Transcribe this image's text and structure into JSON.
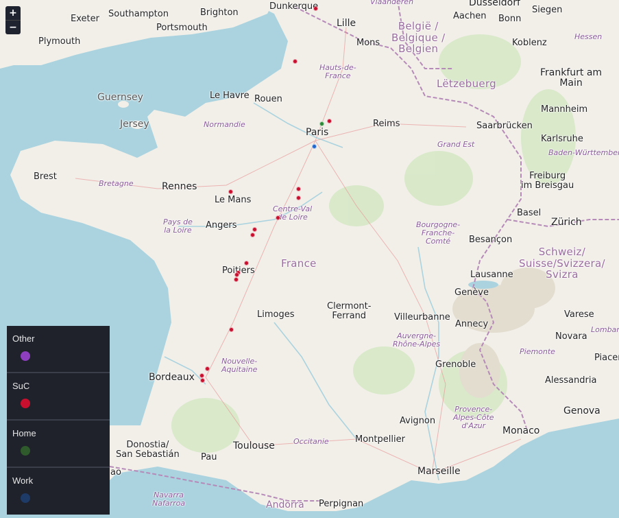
{
  "zoom": {
    "in_label": "+",
    "out_label": "−"
  },
  "places": {
    "dunkerque": "Dunkerque",
    "southampton": "Southampton",
    "brighton": "Brighton",
    "exeter": "Exeter",
    "portsmouth": "Portsmouth",
    "plymouth": "Plymouth",
    "lille": "Lille",
    "mons": "Mons",
    "dusseldorf": "Düsseldorf",
    "aachen": "Aachen",
    "bonn": "Bonn",
    "siegen": "Siegen",
    "koblenz": "Koblenz",
    "hessen": "Hessen",
    "frankfurt": "Frankfurt am\nMain",
    "guernsey": "Guernsey",
    "jersey": "Jersey",
    "le_havre": "Le Havre",
    "rouen": "Rouen",
    "normandie": "Normandie",
    "paris": "Paris",
    "reims": "Reims",
    "saarbrucken": "Saarbrücken",
    "mannheim": "Mannheim",
    "karlsruhe": "Karlsruhe",
    "baden": "Baden-Württemberg",
    "grand_est": "Grand Est",
    "brest": "Brest",
    "bretagne": "Bretagne",
    "rennes": "Rennes",
    "le_mans": "Le Mans",
    "angers": "Angers",
    "pays_loire": "Pays de\nla Loire",
    "centre": "Centre-Val\nde Loire",
    "freiburg": "Freiburg\nim Breisgau",
    "basel": "Basel",
    "zurich": "Zürich",
    "bourgogne": "Bourgogne-\nFranche-\nComté",
    "besancon": "Besançon",
    "poitiers": "Poitiers",
    "lausanne": "Lausanne",
    "geneve": "Genève",
    "limoges": "Limoges",
    "clermont": "Clermont-\nFerrand",
    "villeurbanne": "Villeurbanne",
    "annecy": "Annecy",
    "varese": "Varese",
    "lombardia": "Lombar",
    "novara": "Novara",
    "auvergne": "Auvergne-\nRhône-Alpes",
    "piemonte": "Piemonte",
    "piacenza": "Piacer",
    "nouvelle": "Nouvelle-\nAquitaine",
    "bordeaux": "Bordeaux",
    "grenoble": "Grenoble",
    "alessandria": "Alessandria",
    "donostia": "Donostia/\nSan Sebastián",
    "pau": "Pau",
    "toulouse": "Toulouse",
    "occitanie": "Occitanie",
    "montpellier": "Montpellier",
    "avignon": "Avignon",
    "provence": "Provence-\nAlpes-Côte\nd'Azur",
    "monaco": "Monaco",
    "genova": "Genova",
    "marseille": "Marseille",
    "navarra": "Navarra\nNafarroa",
    "andorra": "Andorra",
    "perpignan": "Perpignan",
    "ao": "ao",
    "vlaanderen": "Vlaanderen"
  },
  "countries": {
    "france": "France",
    "belgium": "België /\nBelgique /\nBelgien",
    "luxembourg": "Lëtzebuerg",
    "switzerland": "Schweiz/\nSuisse/Svizzera/\nSvizra",
    "hauts": "Hauts-de-\nFrance"
  },
  "legend": [
    {
      "name": "Other",
      "color": "#8e3fbf"
    },
    {
      "name": "SuC",
      "color": "#c8102e"
    },
    {
      "name": "Home",
      "color": "#2f5a2b"
    },
    {
      "name": "Work",
      "color": "#1e3a66"
    }
  ],
  "points": [
    {
      "category": "SuC",
      "color": "#c8102e"
    },
    {
      "category": "SuC",
      "color": "#c8102e"
    },
    {
      "category": "SuC",
      "color": "#c8102e"
    },
    {
      "category": "Home",
      "color": "#2a8a36"
    },
    {
      "category": "Work",
      "color": "#2266cc"
    },
    {
      "category": "SuC",
      "color": "#c8102e"
    },
    {
      "category": "SuC",
      "color": "#c8102e"
    },
    {
      "category": "SuC",
      "color": "#c8102e"
    },
    {
      "category": "SuC",
      "color": "#c8102e"
    },
    {
      "category": "SuC",
      "color": "#c8102e"
    },
    {
      "category": "SuC",
      "color": "#c8102e"
    },
    {
      "category": "SuC",
      "color": "#c8102e"
    },
    {
      "category": "SuC",
      "color": "#c8102e"
    },
    {
      "category": "SuC",
      "color": "#c8102e"
    },
    {
      "category": "SuC",
      "color": "#c8102e"
    },
    {
      "category": "SuC",
      "color": "#c8102e"
    },
    {
      "category": "SuC",
      "color": "#c8102e"
    },
    {
      "category": "SuC",
      "color": "#c8102e"
    },
    {
      "category": "SuC",
      "color": "#c8102e"
    }
  ]
}
